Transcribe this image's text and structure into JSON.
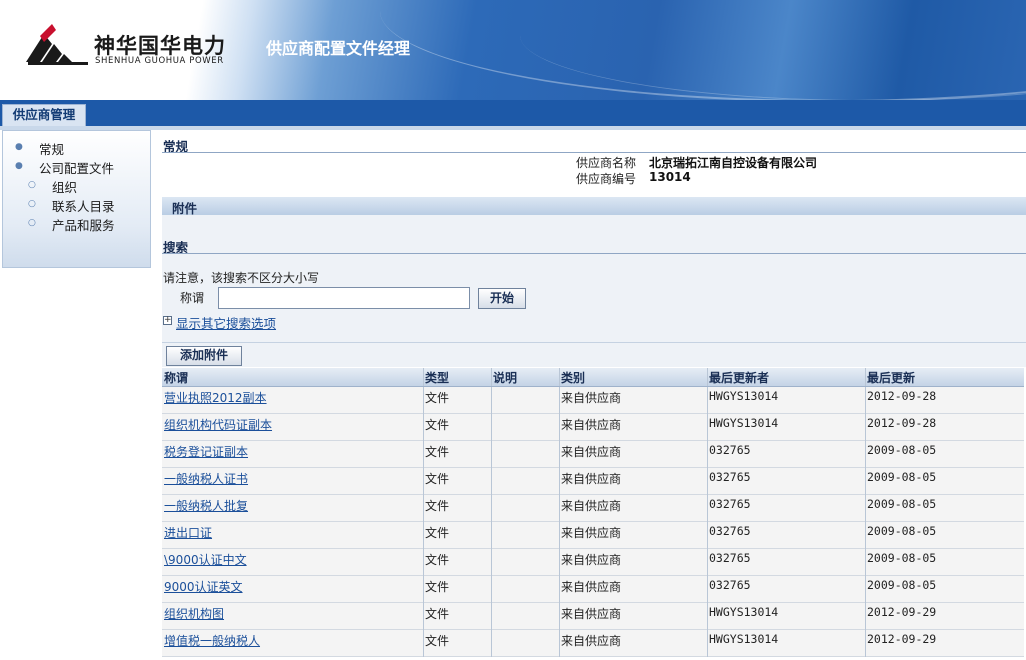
{
  "header": {
    "logo_cn": "神华国华电力",
    "logo_en": "SHENHUA GUOHUA POWER",
    "app_title": "供应商配置文件经理"
  },
  "tabs": [
    {
      "label": "供应商管理",
      "active": true
    }
  ],
  "sidebar": {
    "items": [
      {
        "label": "常规",
        "level": 1
      },
      {
        "label": "公司配置文件",
        "level": 1
      },
      {
        "label": "组织",
        "level": 2
      },
      {
        "label": "联系人目录",
        "level": 2
      },
      {
        "label": "产品和服务",
        "level": 2
      }
    ]
  },
  "general": {
    "title": "常规",
    "supplier_name_label": "供应商名称",
    "supplier_name": "北京瑞拓江南自控设备有限公司",
    "supplier_no_label": "供应商编号",
    "supplier_no": "13014"
  },
  "attachments": {
    "title": "附件",
    "search_title": "搜索",
    "note": "请注意，该搜索不区分大小写",
    "field_label": "称谓",
    "field_value": "",
    "go_button": "开始",
    "more_options": "显示其它搜索选项",
    "add_button": "添加附件",
    "columns": [
      "称谓",
      "类型",
      "说明",
      "类别",
      "最后更新者",
      "最后更新"
    ],
    "rows": [
      {
        "title": "营业执照2012副本",
        "type": "文件",
        "desc": "",
        "category": "来自供应商",
        "updated_by": "HWGYS13014",
        "updated": "2012-09-28"
      },
      {
        "title": "组织机构代码证副本",
        "type": "文件",
        "desc": "",
        "category": "来自供应商",
        "updated_by": "HWGYS13014",
        "updated": "2012-09-28"
      },
      {
        "title": "税务登记证副本",
        "type": "文件",
        "desc": "",
        "category": "来自供应商",
        "updated_by": "032765",
        "updated": "2009-08-05"
      },
      {
        "title": "一般纳税人证书",
        "type": "文件",
        "desc": "",
        "category": "来自供应商",
        "updated_by": "032765",
        "updated": "2009-08-05"
      },
      {
        "title": "一般纳税人批复",
        "type": "文件",
        "desc": "",
        "category": "来自供应商",
        "updated_by": "032765",
        "updated": "2009-08-05"
      },
      {
        "title": "进出口证",
        "type": "文件",
        "desc": "",
        "category": "来自供应商",
        "updated_by": "032765",
        "updated": "2009-08-05"
      },
      {
        "title": "\\9000认证中文",
        "type": "文件",
        "desc": "",
        "category": "来自供应商",
        "updated_by": "032765",
        "updated": "2009-08-05"
      },
      {
        "title": "9000认证英文",
        "type": "文件",
        "desc": "",
        "category": "来自供应商",
        "updated_by": "032765",
        "updated": "2009-08-05"
      },
      {
        "title": "组织机构图",
        "type": "文件",
        "desc": "",
        "category": "来自供应商",
        "updated_by": "HWGYS13014",
        "updated": "2012-09-29"
      },
      {
        "title": "增值税一般纳税人",
        "type": "文件",
        "desc": "",
        "category": "来自供应商",
        "updated_by": "HWGYS13014",
        "updated": "2012-09-29"
      }
    ]
  },
  "colors": {
    "brand_blue": "#1d59a8",
    "link": "#1b4f9a",
    "logo_red": "#c8102e"
  }
}
